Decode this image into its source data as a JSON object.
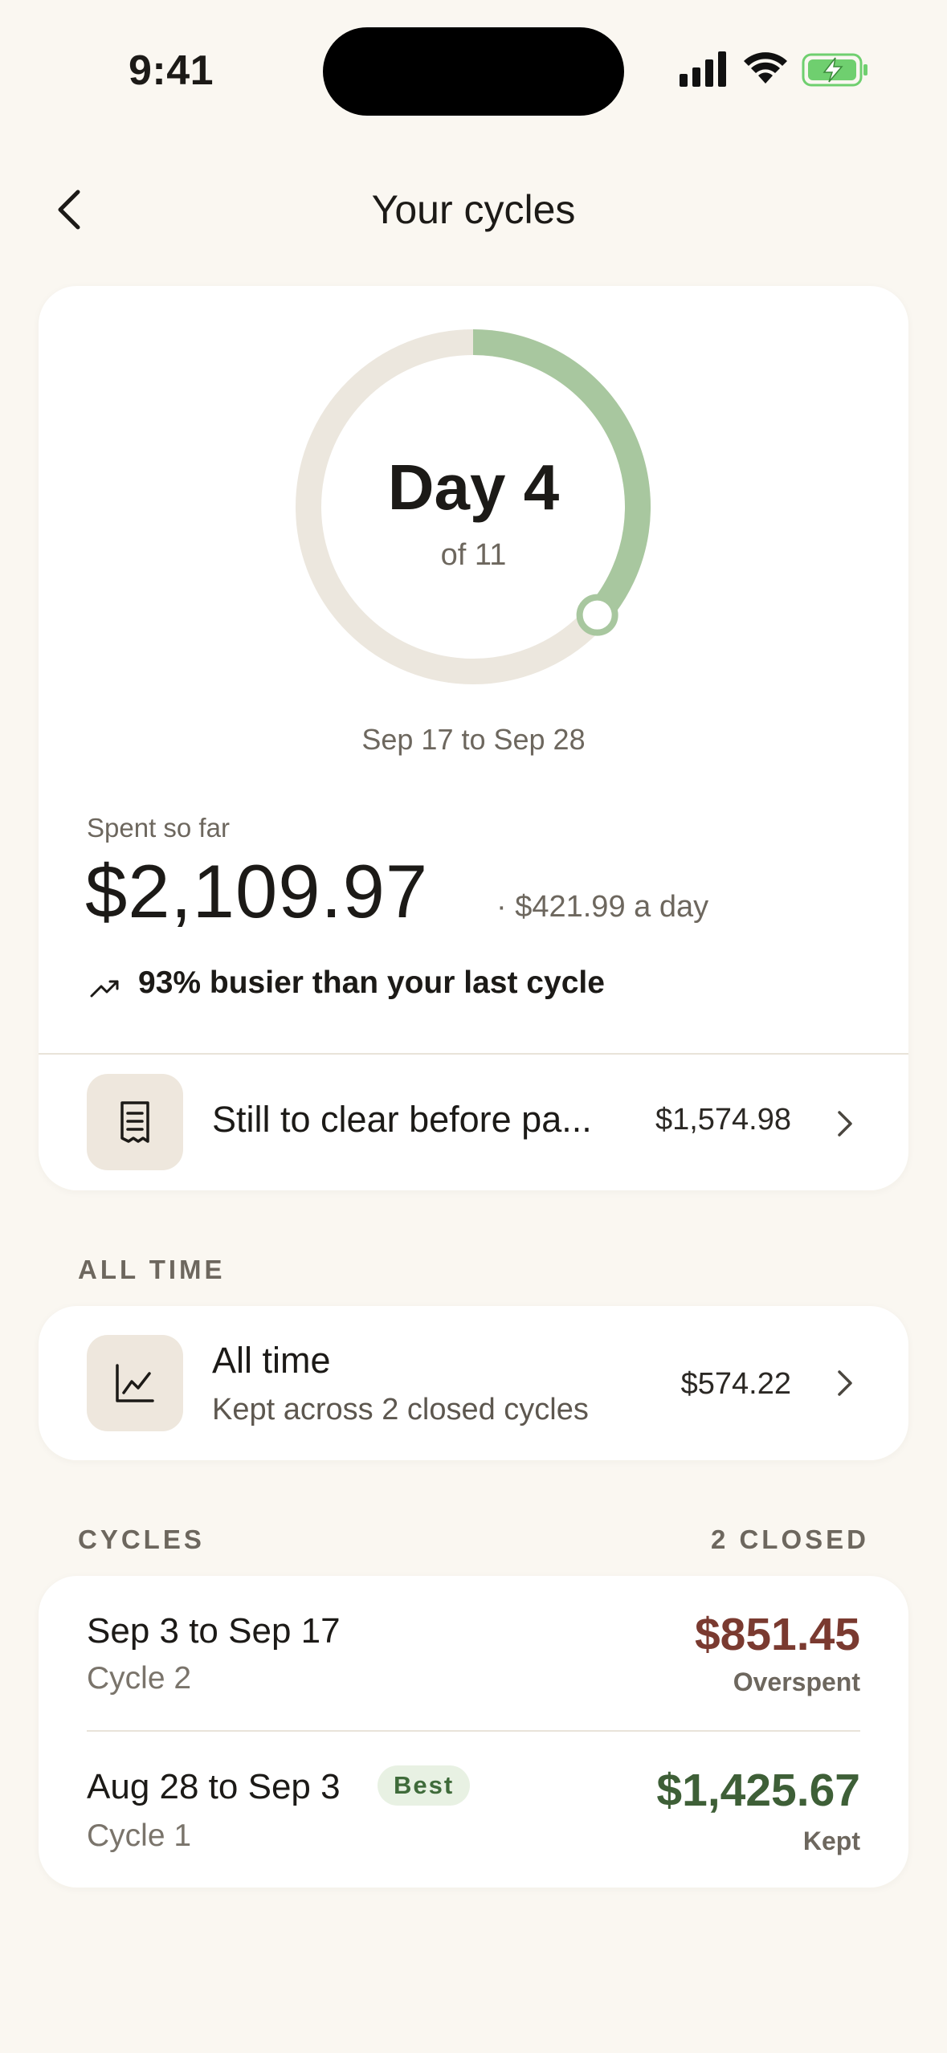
{
  "status_bar": {
    "time": "9:41"
  },
  "nav": {
    "title": "Your cycles"
  },
  "current_cycle": {
    "day_label": "Day 4",
    "day_of": "of 11",
    "progress_fraction": 0.364,
    "date_range": "Sep 17 to Sep 28",
    "spent_label": "Spent so far",
    "spent_amount": "$2,109.97",
    "per_day": "· $421.99 a day",
    "trend_text": "93% busier than your last cycle",
    "clear_row": {
      "label": "Still to clear before pa...",
      "amount": "$1,574.98"
    }
  },
  "all_time_section": {
    "header": "ALL TIME",
    "title": "All time",
    "subtitle": "Kept across 2 closed cycles",
    "amount": "$574.22"
  },
  "cycles_section": {
    "header": "CYCLES",
    "count": "2 CLOSED",
    "items": [
      {
        "dates": "Sep 3 to Sep 17",
        "name": "Cycle 2",
        "amount": "$851.45",
        "status": "Overspent",
        "color": "#7a3a30"
      },
      {
        "dates": "Aug 28 to Sep 3",
        "name": "Cycle 1",
        "badge": "Best",
        "amount": "$1,425.67",
        "status": "Kept",
        "color": "#3e5f37"
      }
    ]
  },
  "colors": {
    "ring_track": "#ece7de",
    "ring_progress": "#a8c79f",
    "background": "#faf7f1"
  }
}
